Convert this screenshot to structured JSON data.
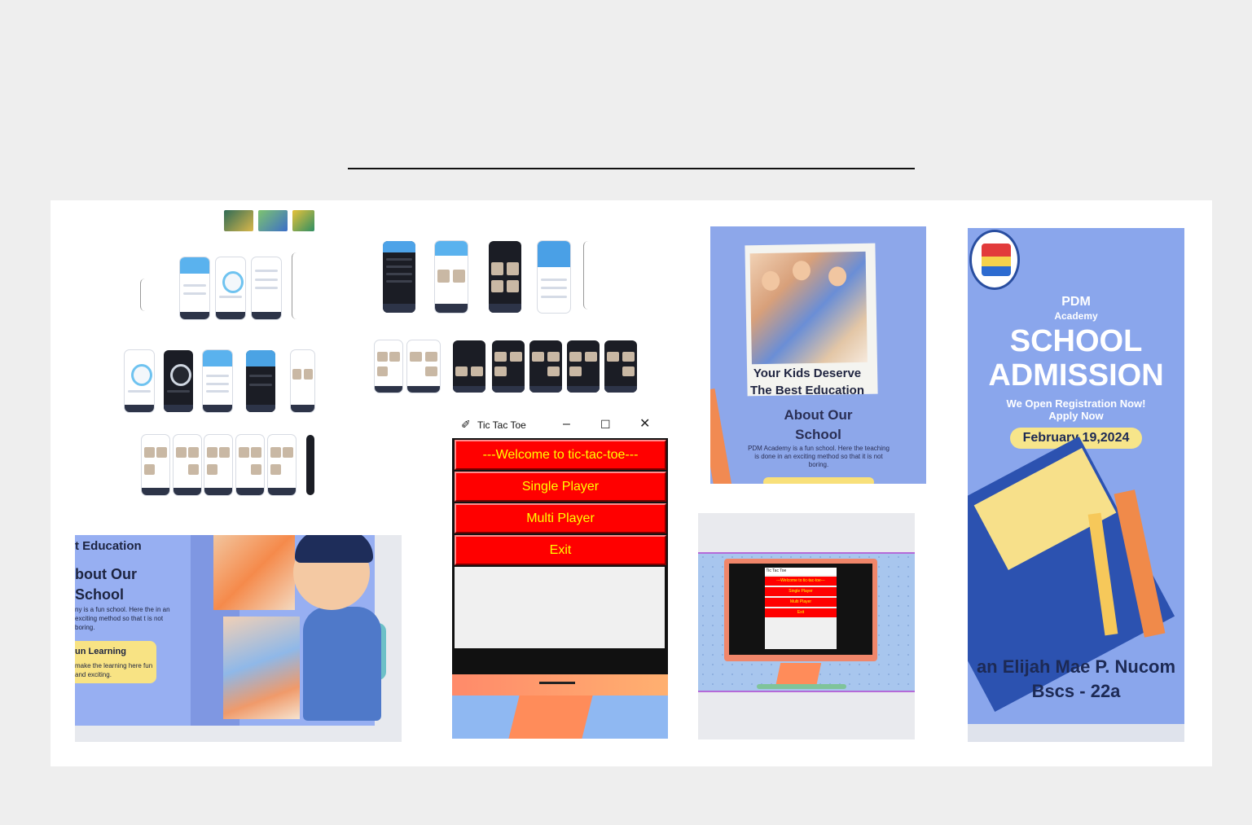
{
  "tic_tac_toe": {
    "window_title": "Tic Tac Toe",
    "welcome_label": "---Welcome to tic-tac-toe---",
    "single_player_label": "Single Player",
    "multi_player_label": "Multi Player",
    "exit_label": "Exit"
  },
  "school_card": {
    "tagline_line1": "Your Kids Deserve",
    "tagline_line2": "The Best Education",
    "about_line1": "About Our",
    "about_line2": "School",
    "body": "PDM Academy is a fun school. Here the teaching is done in an exciting method so that it is not boring."
  },
  "education_crop": {
    "heading": "t Education",
    "about_line1": "bout Our",
    "about_line2": "School",
    "body": "ny is a fun school. Here the in an exciting method so that t is not boring.",
    "fun_title": "un Learning",
    "fun_body": "make the learning here fun and exciting."
  },
  "poster": {
    "pdm": "PDM",
    "academy": "Academy",
    "school": "SCHOOL",
    "admission": "ADMISSION",
    "registration": "We Open Registration Now!",
    "apply": "Apply Now",
    "date": "February 19,2024",
    "name": "an Elijah Mae P. Nucom",
    "class": "Bscs - 22a"
  },
  "small_monitor": {
    "window_title": "Tic Tac Toe",
    "welcome_label": "---Welcome to tic-tac-toe---",
    "single_player_label": "Single Player",
    "multi_player_label": "Multi Player",
    "exit_label": "Exit"
  },
  "icons": {
    "window_app": "feather-icon",
    "minimize": "minimize-icon",
    "maximize": "maximize-icon",
    "close": "close-icon"
  },
  "colors": {
    "page_background": "#eeeeee",
    "gallery_background": "#ffffff",
    "button_red": "#ff0000",
    "button_text_yellow": "#ffff00",
    "poster_blue": "#8aa6ec",
    "date_pill_yellow": "#f7e58a"
  }
}
